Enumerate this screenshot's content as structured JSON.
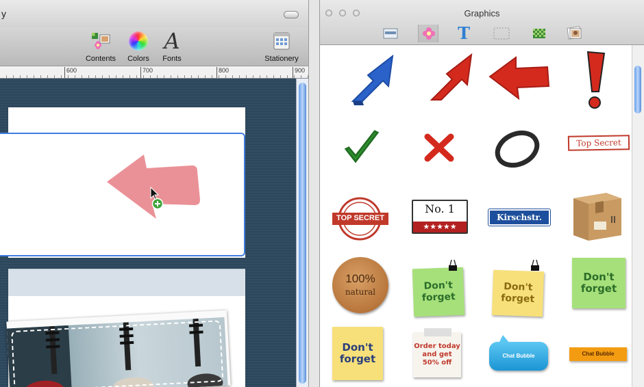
{
  "document_window": {
    "title_fragment": "y",
    "toolbar": {
      "contents_label": "Contents",
      "colors_label": "Colors",
      "fonts_label": "Fonts",
      "stationery_label": "Stationery"
    },
    "ruler_marks": [
      "600",
      "700",
      "800",
      "900"
    ]
  },
  "graphics_panel": {
    "title": "Graphics",
    "tabs": [
      "backgrounds",
      "flowers",
      "text",
      "borders",
      "patterns",
      "photos"
    ],
    "selected_tab": "flowers",
    "items": {
      "top_secret_stamp": "Top Secret",
      "top_secret_seal": "TOP SECRET",
      "no1_label": "No. 1",
      "no1_stars": "★★★★★",
      "street_sign": "Kirschstr.",
      "natural_percent": "100%",
      "natural_word": "natural",
      "dont_forget": "Don't\nforget",
      "order_today": "Order today\nand get\n50% off",
      "chat_bubble": "Chat Bubble"
    }
  },
  "colors": {
    "accent_blue": "#3e7de0",
    "arrow_red": "#d42a1e",
    "arrow_blue": "#2a62c9",
    "ghost_arrow": "#e98b91",
    "note_green": "#a6e07a",
    "note_yellow": "#f7e07a"
  }
}
